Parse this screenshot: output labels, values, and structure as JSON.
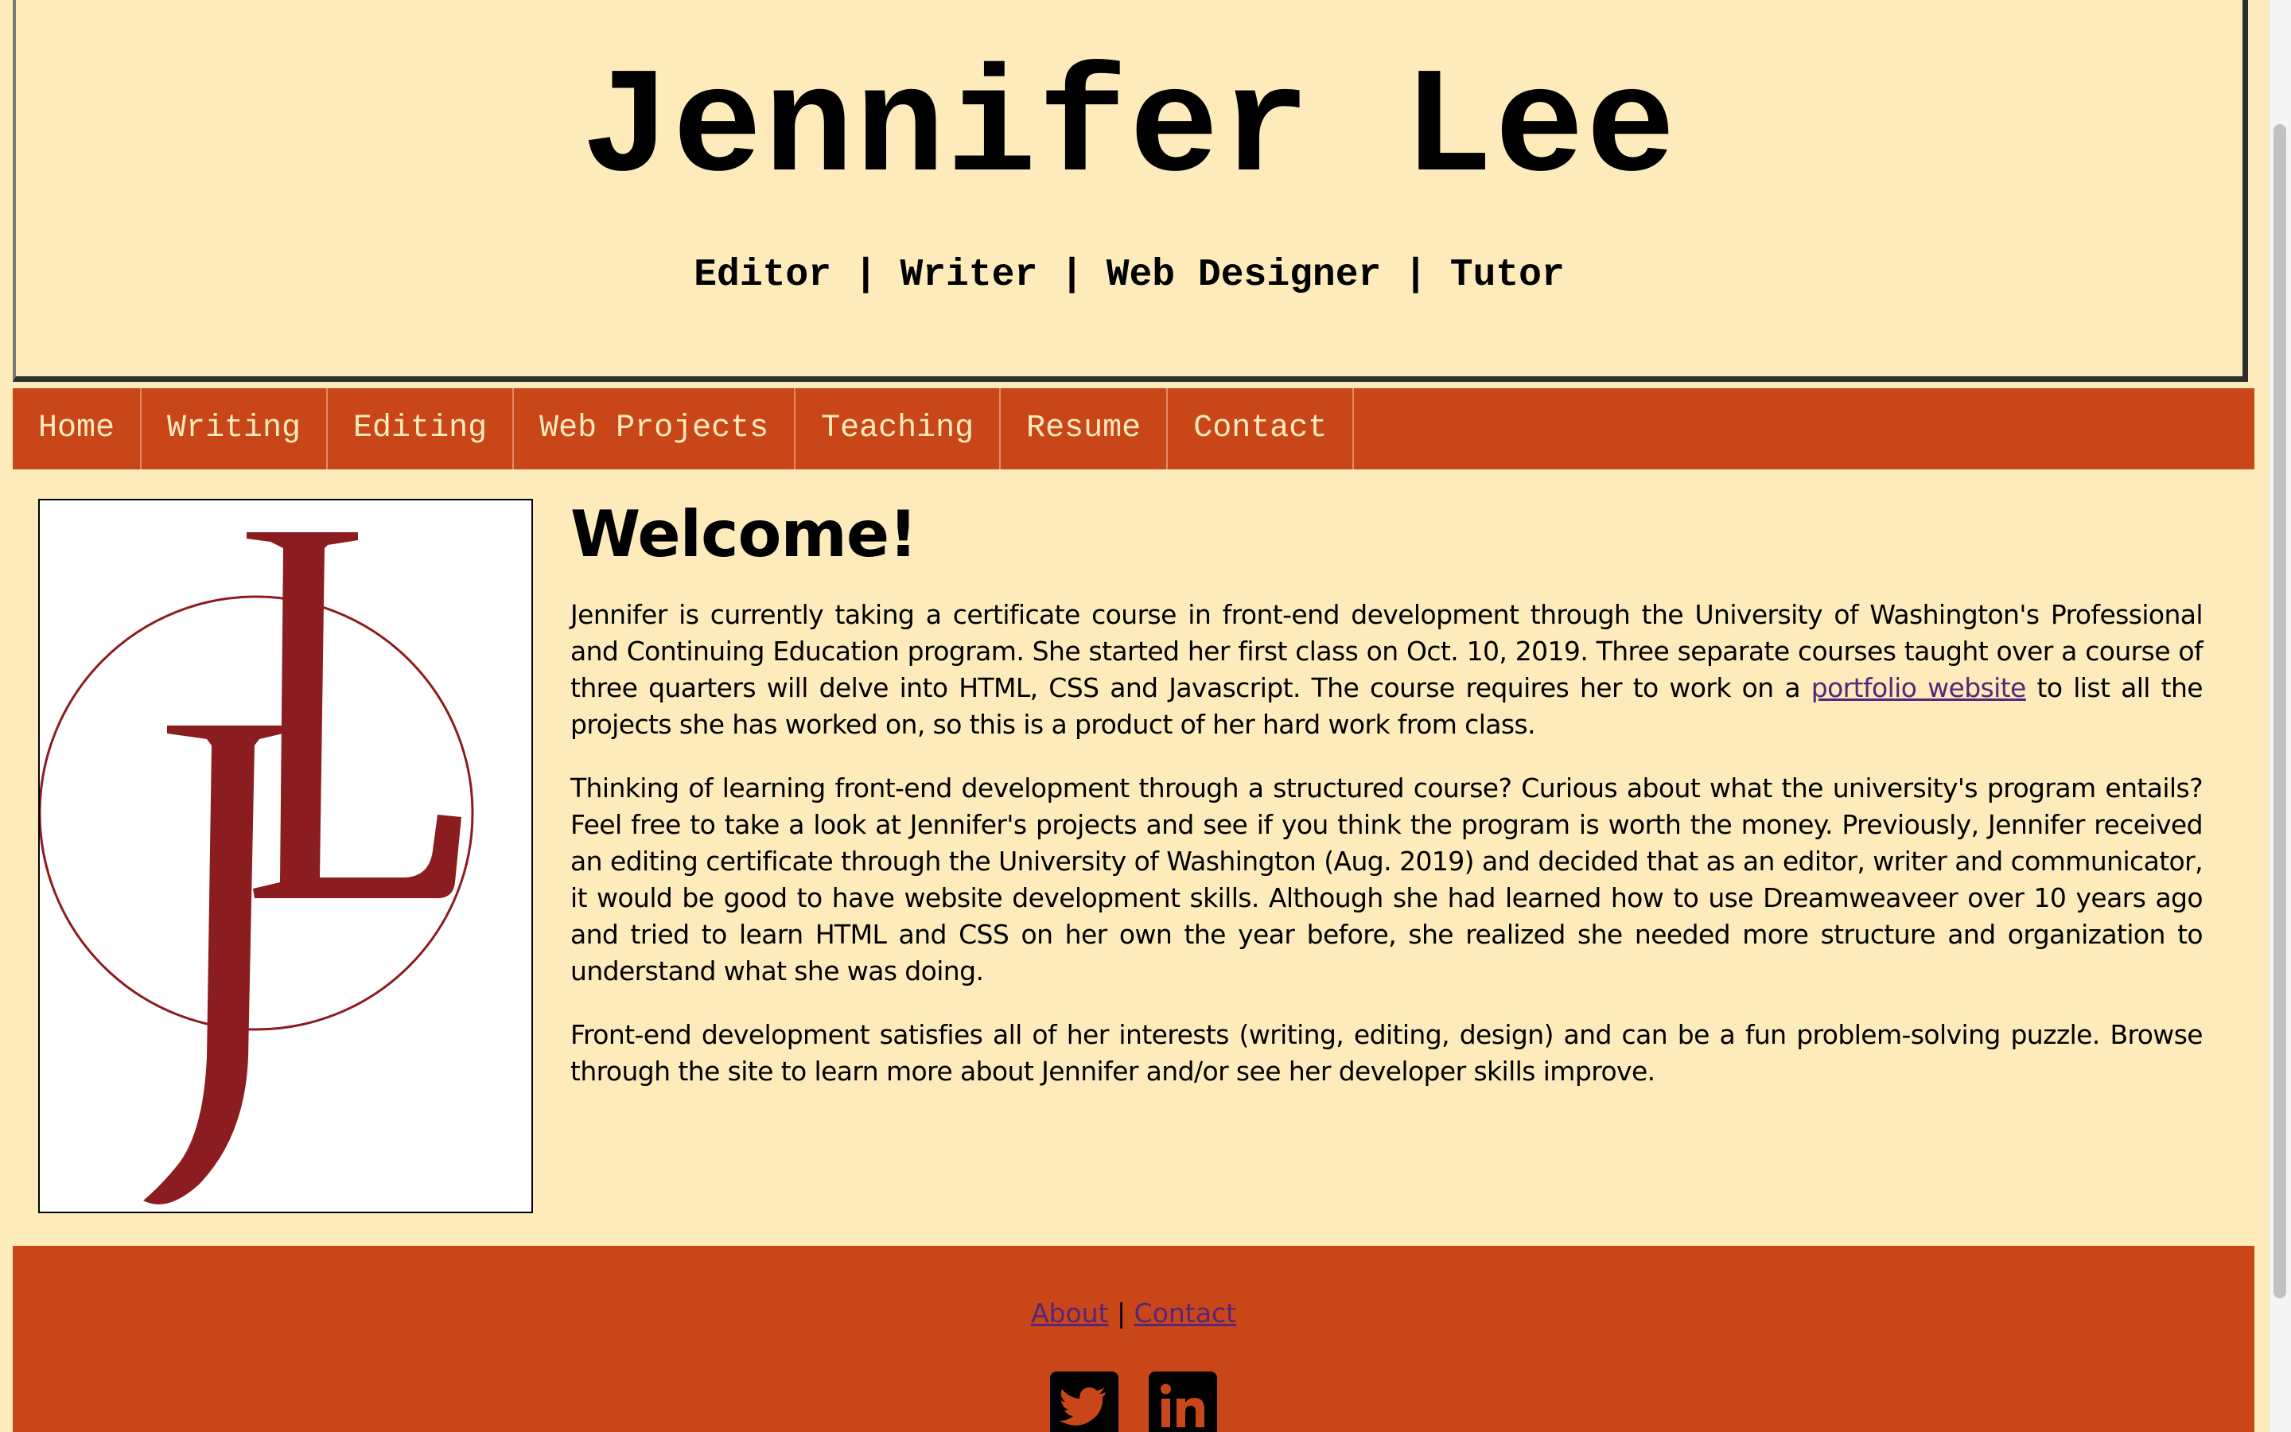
{
  "header": {
    "title": "Jennifer Lee",
    "tagline": "Editor | Writer | Web Designer | Tutor"
  },
  "nav": {
    "items": [
      {
        "label": "Home"
      },
      {
        "label": "Writing"
      },
      {
        "label": "Editing"
      },
      {
        "label": "Web Projects"
      },
      {
        "label": "Teaching"
      },
      {
        "label": "Resume"
      },
      {
        "label": "Contact"
      }
    ]
  },
  "main": {
    "logo_letters": "JL",
    "heading": "Welcome!",
    "para1": {
      "before": "Jennifer is currently taking a certificate course in front-end development through the University of Washington's Professional and Continuing Education program. She started her first class on Oct. 10, 2019. Three separate courses taught over a course of three quarters will delve into HTML, CSS and Javascript. The course requires her to work on a ",
      "link": "portfolio website",
      "after": " to list all the projects she has worked on, so this is a product of her hard work from class."
    },
    "para2": "Thinking of learning front-end development through a structured course? Curious about what the university's program entails? Feel free to take a look at Jennifer's projects and see if you think the program is worth the money. Previously, Jennifer received an editing certificate through the University of Washington (Aug. 2019) and decided that as an editor, writer and communicator, it would be good to have website development skills. Although she had learned how to use Dreamweaveer over 10 years ago and tried to learn HTML and CSS on her own the year before, she realized she needed more structure and organization to understand what she was doing.",
    "para3": "Front-end development satisfies all of her interests (writing, editing, design) and can be a fun problem-solving puzzle. Browse through the site to learn more about Jennifer and/or see her developer skills improve."
  },
  "footer": {
    "about": "About",
    "separator": "|",
    "contact": "Contact",
    "social": [
      "twitter-icon",
      "linkedin-icon"
    ]
  },
  "colors": {
    "background": "#fdebbb",
    "accent": "#c94618",
    "logo": "#8b1c1f",
    "link": "#55267a"
  }
}
